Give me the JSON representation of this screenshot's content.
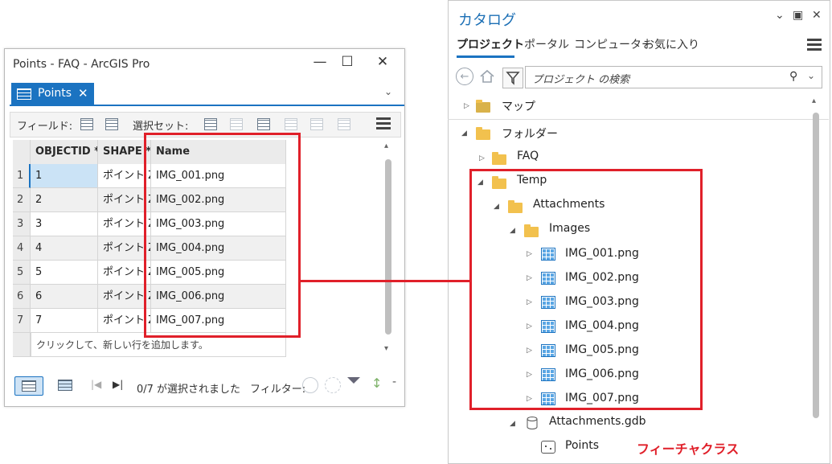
{
  "left_window": {
    "title": "Points - FAQ - ArcGIS Pro",
    "minimize": "—",
    "maximize": "☐",
    "close": "✕",
    "tab_label": "Points",
    "tab_close": "✕",
    "tab_dropdown": "⌄",
    "toolbar": {
      "fields_label": "フィールド:",
      "selection_label": "選択セット:"
    },
    "columns": [
      "OBJECTID *",
      "SHAPE *",
      "Name"
    ],
    "rows": [
      {
        "n": "1",
        "oid": "1",
        "shape": "ポイント Z",
        "name": "IMG_001.png"
      },
      {
        "n": "2",
        "oid": "2",
        "shape": "ポイント Z",
        "name": "IMG_002.png"
      },
      {
        "n": "3",
        "oid": "3",
        "shape": "ポイント Z",
        "name": "IMG_003.png"
      },
      {
        "n": "4",
        "oid": "4",
        "shape": "ポイント Z",
        "name": "IMG_004.png"
      },
      {
        "n": "5",
        "oid": "5",
        "shape": "ポイント Z",
        "name": "IMG_005.png"
      },
      {
        "n": "6",
        "oid": "6",
        "shape": "ポイント Z",
        "name": "IMG_006.png"
      },
      {
        "n": "7",
        "oid": "7",
        "shape": "ポイント Z",
        "name": "IMG_007.png"
      }
    ],
    "add_row_text": "クリックして、新しい行を追加します。",
    "status": {
      "selected": "0/7 が選択されました",
      "filter_label": "フィルター:"
    }
  },
  "catalog": {
    "title": "カタログ",
    "tabs": [
      "プロジェクト",
      "ポータル",
      "コンピューター",
      "お気に入り"
    ],
    "search_placeholder": "プロジェクト の検索",
    "tree": {
      "maps": "マップ",
      "folders": "フォルダー",
      "faq": "FAQ",
      "temp": "Temp",
      "attachments": "Attachments",
      "images": "Images",
      "files": [
        "IMG_001.png",
        "IMG_002.png",
        "IMG_003.png",
        "IMG_004.png",
        "IMG_005.png",
        "IMG_006.png",
        "IMG_007.png"
      ],
      "gdb": "Attachments.gdb",
      "points": "Points"
    }
  },
  "annotation": {
    "feature_class_label": "フィーチャクラス",
    "color": "#e0202a"
  },
  "colors": {
    "accent": "#1b73c1",
    "highlight": "#e0202a"
  }
}
